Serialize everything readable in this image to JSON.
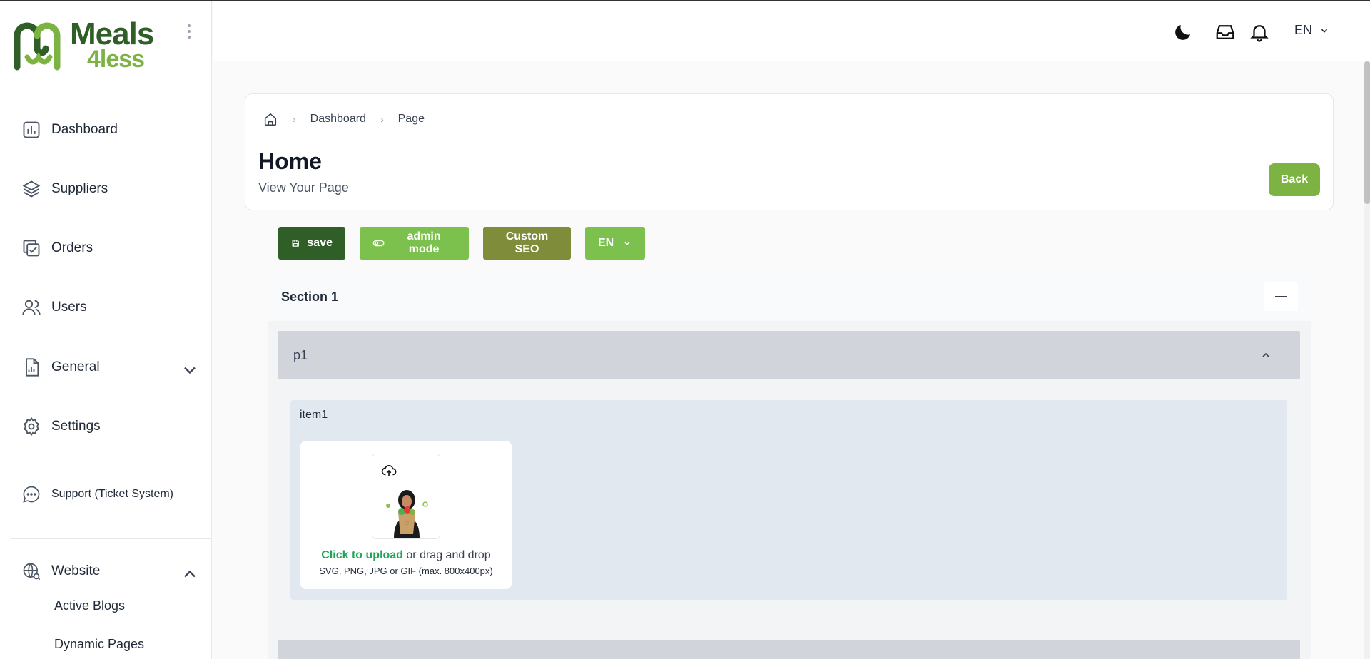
{
  "brand": {
    "name_line1": "Meals",
    "name_line2": "4less",
    "primary": "#2f5e27",
    "accent": "#7cb342"
  },
  "sidebar": {
    "items": [
      {
        "label": "Dashboard",
        "icon": "bar-chart-icon"
      },
      {
        "label": "Suppliers",
        "icon": "layers-icon"
      },
      {
        "label": "Orders",
        "icon": "clipboard-check-icon"
      },
      {
        "label": "Users",
        "icon": "users-icon"
      },
      {
        "label": "General",
        "icon": "report-file-icon"
      },
      {
        "label": "Settings",
        "icon": "gear-icon"
      },
      {
        "label": "Support (Ticket System)",
        "icon": "chat-bubble-icon"
      },
      {
        "label": "Website",
        "icon": "globe-search-icon"
      }
    ],
    "website_sub": [
      "Active Blogs",
      "Dynamic Pages"
    ]
  },
  "header": {
    "language": "EN"
  },
  "breadcrumb": {
    "items": [
      "Dashboard",
      "Page"
    ]
  },
  "page": {
    "title": "Home",
    "subtitle": "View Your Page",
    "back_label": "Back"
  },
  "toolbar": {
    "save_label": "save",
    "admin_label": "admin mode",
    "seo_label": "Custom SEO",
    "lang_label": "EN"
  },
  "section": {
    "title": "Section 1",
    "panel_title": "p1",
    "item_title": "item1",
    "upload": {
      "link_text": "Click to upload",
      "rest_text": " or drag and drop",
      "hint": "SVG, PNG, JPG or GIF (max. 800x400px)"
    }
  }
}
